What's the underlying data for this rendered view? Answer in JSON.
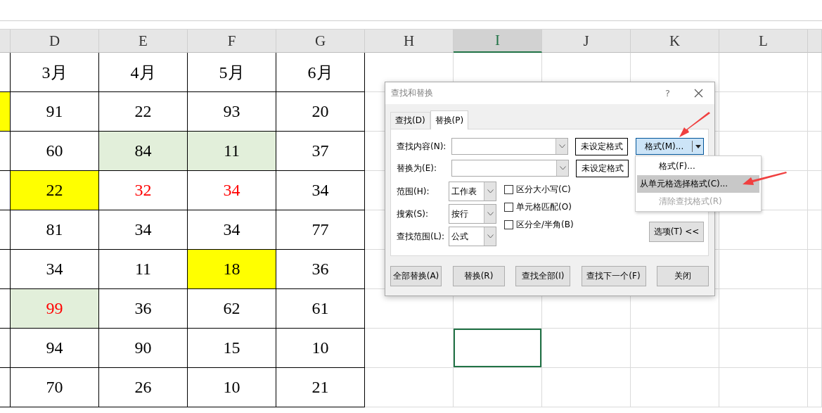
{
  "columns": [
    {
      "label": "D",
      "selected": false
    },
    {
      "label": "E",
      "selected": false
    },
    {
      "label": "F",
      "selected": false
    },
    {
      "label": "G",
      "selected": false
    },
    {
      "label": "H",
      "selected": false
    },
    {
      "label": "I",
      "selected": true
    },
    {
      "label": "J",
      "selected": false
    },
    {
      "label": "K",
      "selected": false
    },
    {
      "label": "L",
      "selected": false
    }
  ],
  "rows": [
    {
      "selected": false,
      "cells": [
        {},
        {
          "text": "3月"
        },
        {
          "text": "4月"
        },
        {
          "text": "5月"
        },
        {
          "text": "6月"
        }
      ]
    },
    {
      "selected": false,
      "cells": [
        {
          "color": "#ffff00"
        },
        {
          "text": "91"
        },
        {
          "text": "22"
        },
        {
          "text": "93"
        },
        {
          "text": "20"
        }
      ]
    },
    {
      "selected": false,
      "cells": [
        {},
        {
          "text": "60"
        },
        {
          "text": "84",
          "color": "#e2efda"
        },
        {
          "text": "11",
          "color": "#e2efda"
        },
        {
          "text": "37"
        }
      ]
    },
    {
      "selected": false,
      "cells": [
        {},
        {
          "text": "22",
          "color": "#ffff00"
        },
        {
          "text": "32",
          "red_text": true
        },
        {
          "text": "34",
          "red_text": true
        },
        {
          "text": "34"
        }
      ]
    },
    {
      "selected": false,
      "cells": [
        {},
        {
          "text": "81"
        },
        {
          "text": "34"
        },
        {
          "text": "34"
        },
        {
          "text": "77"
        }
      ]
    },
    {
      "selected": false,
      "cells": [
        {},
        {
          "text": "34"
        },
        {
          "text": "11"
        },
        {
          "text": "18",
          "color": "#ffff00"
        },
        {
          "text": "36"
        }
      ]
    },
    {
      "selected": false,
      "cells": [
        {},
        {
          "text": "99",
          "color": "#e2efda",
          "red_text": true
        },
        {
          "text": "36"
        },
        {
          "text": "62"
        },
        {
          "text": "61"
        }
      ]
    },
    {
      "selected": true,
      "cells": [
        {},
        {
          "text": "94"
        },
        {
          "text": "90"
        },
        {
          "text": "15"
        },
        {
          "text": "10"
        }
      ]
    },
    {
      "selected": false,
      "cells": [
        {},
        {
          "text": "70"
        },
        {
          "text": "26"
        },
        {
          "text": "10"
        },
        {
          "text": "21"
        }
      ]
    }
  ],
  "dialog": {
    "title": "查找和替换",
    "help": "?",
    "tabs": [
      {
        "label": "查找(D)",
        "selected": false
      },
      {
        "label": "替换(P)",
        "selected": true
      }
    ],
    "fields": [
      {
        "label": "查找内容(N):",
        "format_button": "未设定格式"
      },
      {
        "label": "替换为(E):",
        "format_button": "未设定格式"
      }
    ],
    "format_button": {
      "label": "格式(M)...",
      "pressed": true
    },
    "format_menu": [
      {
        "label": "格式(F)...",
        "highlighted": false,
        "disabled": false
      },
      {
        "label": "从单元格选择格式(C)...",
        "highlighted": true,
        "disabled": false
      },
      {
        "label": "清除查找格式(R)",
        "highlighted": false,
        "disabled": true
      }
    ],
    "options": [
      {
        "label": "范围(H):",
        "value": "工作表"
      },
      {
        "label": "搜索(S):",
        "value": "按行"
      },
      {
        "label": "查找范围(L):",
        "value": "公式"
      }
    ],
    "checkboxes": [
      {
        "label": "区分大小写(C)",
        "checked": false
      },
      {
        "label": "单元格匹配(O)",
        "checked": false
      },
      {
        "label": "区分全/半角(B)",
        "checked": false
      }
    ],
    "options_button": "选项(T) <<",
    "buttons": [
      "全部替换(A)",
      "替换(R)",
      "查找全部(I)",
      "查找下一个(F)",
      "关闭"
    ]
  }
}
